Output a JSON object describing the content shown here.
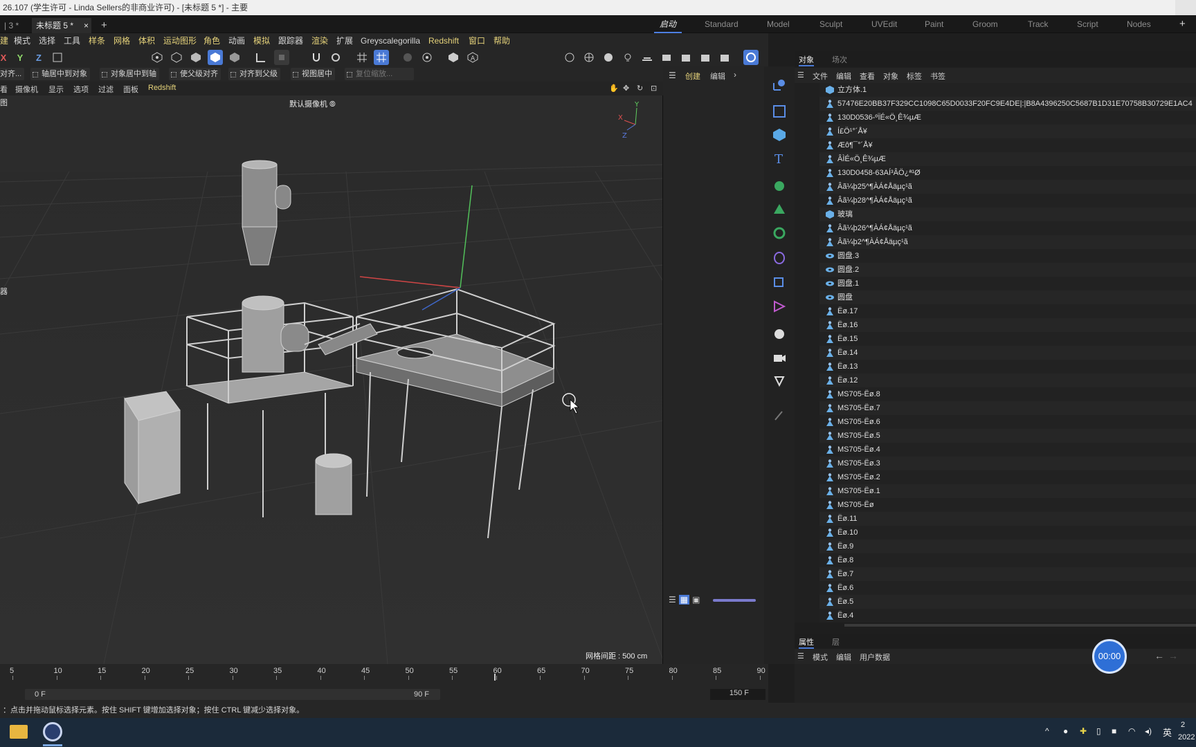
{
  "window": {
    "title": "26.107  (学生许可 - Linda Sellers的非商业许可)  - [未标题 5 *] - 主要"
  },
  "doc_tabs": [
    {
      "label": "| 3 *"
    },
    {
      "label": "未标题 5 *"
    },
    {
      "label": "×"
    },
    {
      "label": "+"
    }
  ],
  "layouts": [
    "启动",
    "Standard",
    "Model",
    "Sculpt",
    "UVEdit",
    "Paint",
    "Groom",
    "Track",
    "Script",
    "Nodes",
    "+"
  ],
  "menu": [
    "建",
    "模式",
    "选择",
    "工具",
    "样条",
    "网格",
    "体积",
    "运动图形",
    "角色",
    "动画",
    "模拟",
    "跟踪器",
    "渲染",
    "扩展",
    "Greyscalegorilla",
    "Redshift",
    "窗口",
    "帮助"
  ],
  "axis_buttons": [
    "X",
    "Y",
    "Z"
  ],
  "toolbar2": [
    "对齐...",
    "轴居中到对象",
    "对象居中到轴",
    "使父级对齐",
    "对齐到父级",
    "视图居中",
    "复位缩放..."
  ],
  "cmd_panel": {
    "create": "创建",
    "edit": "编辑",
    "arrow": "›"
  },
  "viewport": {
    "menu": [
      "看",
      "摄像机",
      "显示",
      "选项",
      "过滤",
      "面板",
      "Redshift"
    ],
    "label_left": "图",
    "camera": "默认摄像机 ⦾",
    "side_label": "器",
    "grid_spacing": "网格间距 : 500 cm",
    "gizmo": {
      "x": "X",
      "y": "Y",
      "z": "Z"
    }
  },
  "object_manager": {
    "tabs": [
      "对象",
      "场次"
    ],
    "menu": [
      "文件",
      "编辑",
      "查看",
      "对象",
      "标签",
      "书签"
    ],
    "objects": [
      {
        "name": "立方体.1",
        "icon": "cube"
      },
      {
        "name": "57476E20BB37F329CC1098C65D0033F20FC9E4DE|:|B8A4396250C5687B1D31E70758B30729E1AC4",
        "icon": "figure"
      },
      {
        "name": "130D0536-ºÏÉ«Ö¸Ê¾µÆ",
        "icon": "figure"
      },
      {
        "name": "Í£Ö¹°´Å¥",
        "icon": "figure"
      },
      {
        "name": "Æô¶¯°´Å¥",
        "icon": "figure"
      },
      {
        "name": "ÂÌÉ«Ö¸Ê¾µÆ",
        "icon": "figure"
      },
      {
        "name": "130D0458-63AÍ³ÂÖ¿ª¹Ø",
        "icon": "figure"
      },
      {
        "name": "Âã¼þ25^¶ÀÁ¢Åäµç¹ã",
        "icon": "figure"
      },
      {
        "name": "Âã¼þ28^¶ÀÁ¢Åäµç¹ã",
        "icon": "figure"
      },
      {
        "name": "玻璃",
        "icon": "cube"
      },
      {
        "name": "Âã¼þ26^¶ÀÁ¢Åäµç¹ã",
        "icon": "figure"
      },
      {
        "name": "Âã¼þ2^¶ÀÁ¢Åäµç¹ã",
        "icon": "figure"
      },
      {
        "name": "圆盘.3",
        "icon": "disc"
      },
      {
        "name": "圆盘.2",
        "icon": "disc"
      },
      {
        "name": "圆盘.1",
        "icon": "disc"
      },
      {
        "name": "圆盘",
        "icon": "disc"
      },
      {
        "name": "Ëø.17",
        "icon": "figure"
      },
      {
        "name": "Ëø.16",
        "icon": "figure"
      },
      {
        "name": "Ëø.15",
        "icon": "figure"
      },
      {
        "name": "Ëø.14",
        "icon": "figure"
      },
      {
        "name": "Ëø.13",
        "icon": "figure"
      },
      {
        "name": "Ëø.12",
        "icon": "figure"
      },
      {
        "name": "MS705-Ëø.8",
        "icon": "figure"
      },
      {
        "name": "MS705-Ëø.7",
        "icon": "figure"
      },
      {
        "name": "MS705-Ëø.6",
        "icon": "figure"
      },
      {
        "name": "MS705-Ëø.5",
        "icon": "figure"
      },
      {
        "name": "MS705-Ëø.4",
        "icon": "figure"
      },
      {
        "name": "MS705-Ëø.3",
        "icon": "figure"
      },
      {
        "name": "MS705-Ëø.2",
        "icon": "figure"
      },
      {
        "name": "MS705-Ëø.1",
        "icon": "figure"
      },
      {
        "name": "MS705-Ëø",
        "icon": "figure"
      },
      {
        "name": "Ëø.11",
        "icon": "figure"
      },
      {
        "name": "Ëø.10",
        "icon": "figure"
      },
      {
        "name": "Ëø.9",
        "icon": "figure"
      },
      {
        "name": "Ëø.8",
        "icon": "figure"
      },
      {
        "name": "Ëø.7",
        "icon": "figure"
      },
      {
        "name": "Ëø.6",
        "icon": "figure"
      },
      {
        "name": "Ëø.5",
        "icon": "figure"
      },
      {
        "name": "Ëø.4",
        "icon": "figure"
      }
    ]
  },
  "attributes": {
    "tabs": [
      "属性",
      "层"
    ],
    "menu": [
      "模式",
      "编辑",
      "用户数据"
    ]
  },
  "timer": "00:00",
  "timeline": {
    "ticks": [
      "5",
      "10",
      "15",
      "20",
      "25",
      "30",
      "35",
      "40",
      "45",
      "50",
      "55",
      "60",
      "65",
      "70",
      "75",
      "80",
      "85",
      "90"
    ],
    "start": "0 F",
    "current": "90 F",
    "end": "150 F"
  },
  "status": "：点击并拖动鼠标选择元素。按住 SHIFT 键增加选择对象；按住 CTRL 键减少选择对象。",
  "taskbar": {
    "ime": "英",
    "clock_time": "2",
    "clock_date": "2022"
  },
  "colors": {
    "accent": "#4a7ad6",
    "viewport_bg": "#2d2d2d",
    "menu_highlight": "#e5d27a"
  }
}
